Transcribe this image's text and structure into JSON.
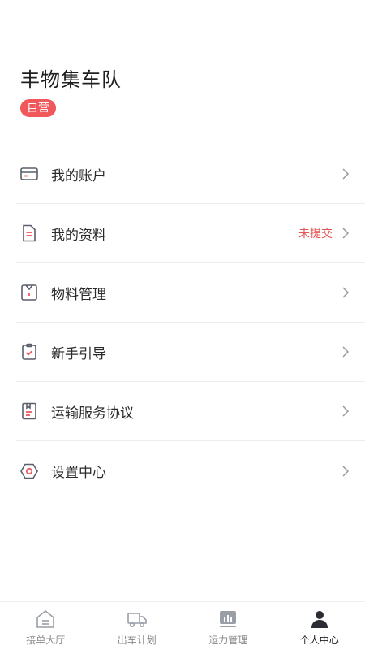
{
  "profile": {
    "name": "丰物集车队",
    "badge": "自营"
  },
  "menu": [
    {
      "label": "我的账户",
      "status": "",
      "icon": "card-icon"
    },
    {
      "label": "我的资料",
      "status": "未提交",
      "icon": "document-icon"
    },
    {
      "label": "物料管理",
      "status": "",
      "icon": "shirt-icon"
    },
    {
      "label": "新手引导",
      "status": "",
      "icon": "clipboard-check-icon"
    },
    {
      "label": "运输服务协议",
      "status": "",
      "icon": "agreement-icon"
    },
    {
      "label": "设置中心",
      "status": "",
      "icon": "hexagon-settings-icon"
    }
  ],
  "tabbar": [
    {
      "label": "接单大厅",
      "icon": "home-icon",
      "active": false
    },
    {
      "label": "出车计划",
      "icon": "truck-icon",
      "active": false
    },
    {
      "label": "运力管理",
      "icon": "chart-icon",
      "active": false
    },
    {
      "label": "个人中心",
      "icon": "person-icon",
      "active": true
    }
  ],
  "colors": {
    "accent": "#f0585b",
    "status": "#e45454",
    "icon_stroke": "#5a5f6b"
  }
}
